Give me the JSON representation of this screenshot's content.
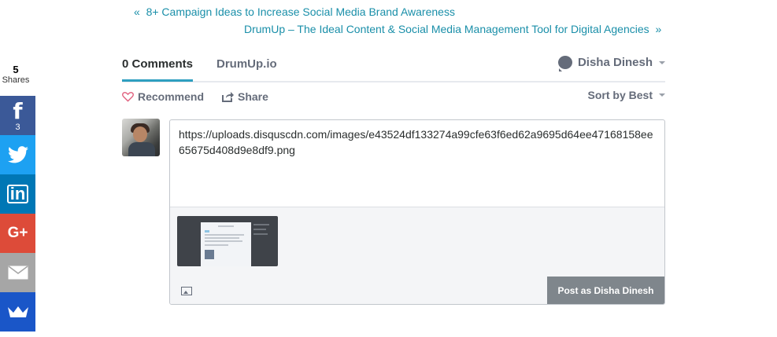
{
  "post_nav": {
    "prev_arrow": "«",
    "prev_title": "8+ Campaign Ideas to Increase Social Media Brand Awareness",
    "next_title": "DrumUp – The Ideal Content & Social Media Management Tool for Digital Agencies",
    "next_arrow": "»"
  },
  "share_bar": {
    "total_count": "5",
    "total_label": "Shares",
    "buttons": [
      {
        "network": "facebook",
        "icon": "facebook-icon",
        "glyph": "f",
        "count": "3",
        "color": "#3b5998"
      },
      {
        "network": "twitter",
        "icon": "twitter-icon",
        "color": "#1da1f2"
      },
      {
        "network": "linkedin",
        "icon": "linkedin-icon",
        "glyph": "in",
        "color": "#0077b5"
      },
      {
        "network": "google-plus",
        "icon": "google-plus-icon",
        "glyph": "G+",
        "color": "#dd4b39"
      },
      {
        "network": "email",
        "icon": "email-icon",
        "color": "#a6a6a6"
      },
      {
        "network": "sumome",
        "icon": "crown-icon",
        "color": "#1a56c8"
      }
    ]
  },
  "comments": {
    "tabs": [
      {
        "label": "0 Comments",
        "active": true
      },
      {
        "label": "DrumUp.io",
        "active": false
      }
    ],
    "user_name": "Disha Dinesh",
    "recommend_label": "Recommend",
    "share_label": "Share",
    "sort_label": "Sort by Best"
  },
  "composer": {
    "text": "https://uploads.disquscdn.com/images/e43524df133274a99cfe63f6ed62a9695d64ee47168158ee65675d408d9e8df9.png",
    "post_button": "Post as Disha Dinesh"
  },
  "colors": {
    "accent": "#2e9fc0",
    "link": "#1a8fa9",
    "post_button": "#7f868c"
  }
}
